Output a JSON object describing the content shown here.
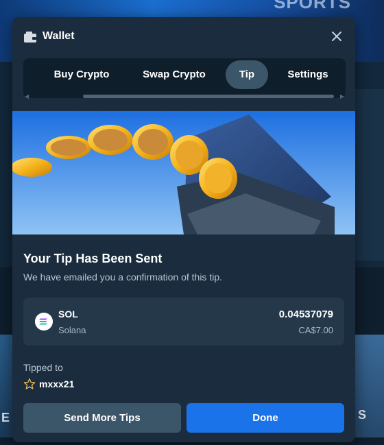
{
  "background": {
    "sports_text": "SPORTS"
  },
  "wallet": {
    "title": "Wallet",
    "icon": "wallet-icon",
    "close_icon": "close-icon"
  },
  "tabs": [
    {
      "label": "Buy Crypto",
      "active": false
    },
    {
      "label": "Swap Crypto",
      "active": false
    },
    {
      "label": "Tip",
      "active": true
    },
    {
      "label": "Settings",
      "active": false
    }
  ],
  "confirmation": {
    "heading": "Your Tip Has Been Sent",
    "subtext": "We have emailed you a confirmation of this tip."
  },
  "coin": {
    "icon": "solana-icon",
    "symbol": "SOL",
    "name": "Solana",
    "amount": "0.04537079",
    "fiat": "CA$7.00"
  },
  "recipient": {
    "label": "Tipped to",
    "icon": "star-icon",
    "username": "mxxx21"
  },
  "buttons": {
    "send_more": "Send More Tips",
    "done": "Done"
  },
  "colors": {
    "modal_bg": "#1a2c3d",
    "accent": "#1a73e8",
    "secondary": "#3c5669"
  }
}
